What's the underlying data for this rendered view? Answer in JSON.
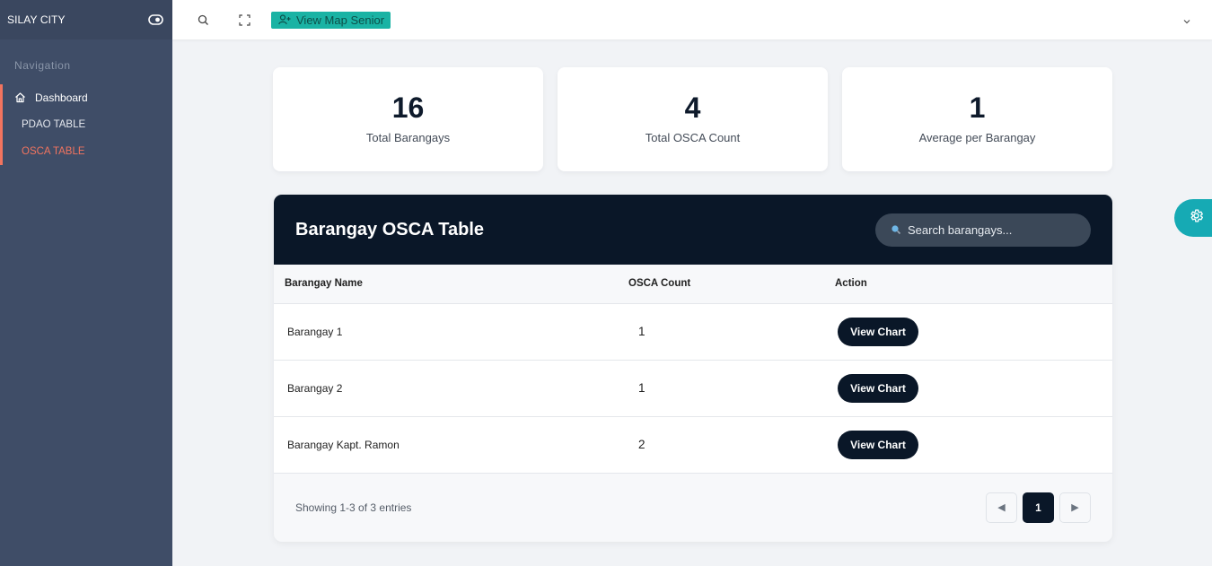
{
  "sidebar": {
    "brand": "SILAY CITY",
    "toggle_icon": "eye-toggle-icon",
    "caption": "Navigation",
    "items": [
      {
        "label": "Dashboard",
        "icon": "home-icon"
      },
      {
        "label": "PDAO TABLE"
      },
      {
        "label": "OSCA TABLE",
        "active": true
      }
    ]
  },
  "header": {
    "search_icon": "search-icon",
    "fullscreen_icon": "fullscreen-icon",
    "map_button_label": "View Map Senior",
    "map_button_icon": "user-plus-icon",
    "dropdown_icon": "chevron-down-icon"
  },
  "stats": [
    {
      "value": "16",
      "label": "Total Barangays"
    },
    {
      "value": "4",
      "label": "Total OSCA Count"
    },
    {
      "value": "1",
      "label": "Average per Barangay"
    }
  ],
  "table": {
    "title": "Barangay OSCA Table",
    "search_placeholder": "Search barangays...",
    "columns": [
      "Barangay Name",
      "OSCA Count",
      "Action"
    ],
    "rows": [
      {
        "name": "Barangay 1",
        "count": "1",
        "action": "View Chart"
      },
      {
        "name": "Barangay 2",
        "count": "1",
        "action": "View Chart"
      },
      {
        "name": "Barangay Kapt. Ramon",
        "count": "2",
        "action": "View Chart"
      }
    ],
    "footer_text": "Showing 1-3 of 3 entries",
    "pagination": {
      "prev": "◀",
      "current": "1",
      "next": "▶"
    }
  },
  "colors": {
    "sidebar_bg": "#3f4d67",
    "accent": "#f2745f",
    "teal": "#1ab3a4",
    "dark_navy": "#0a1728"
  }
}
